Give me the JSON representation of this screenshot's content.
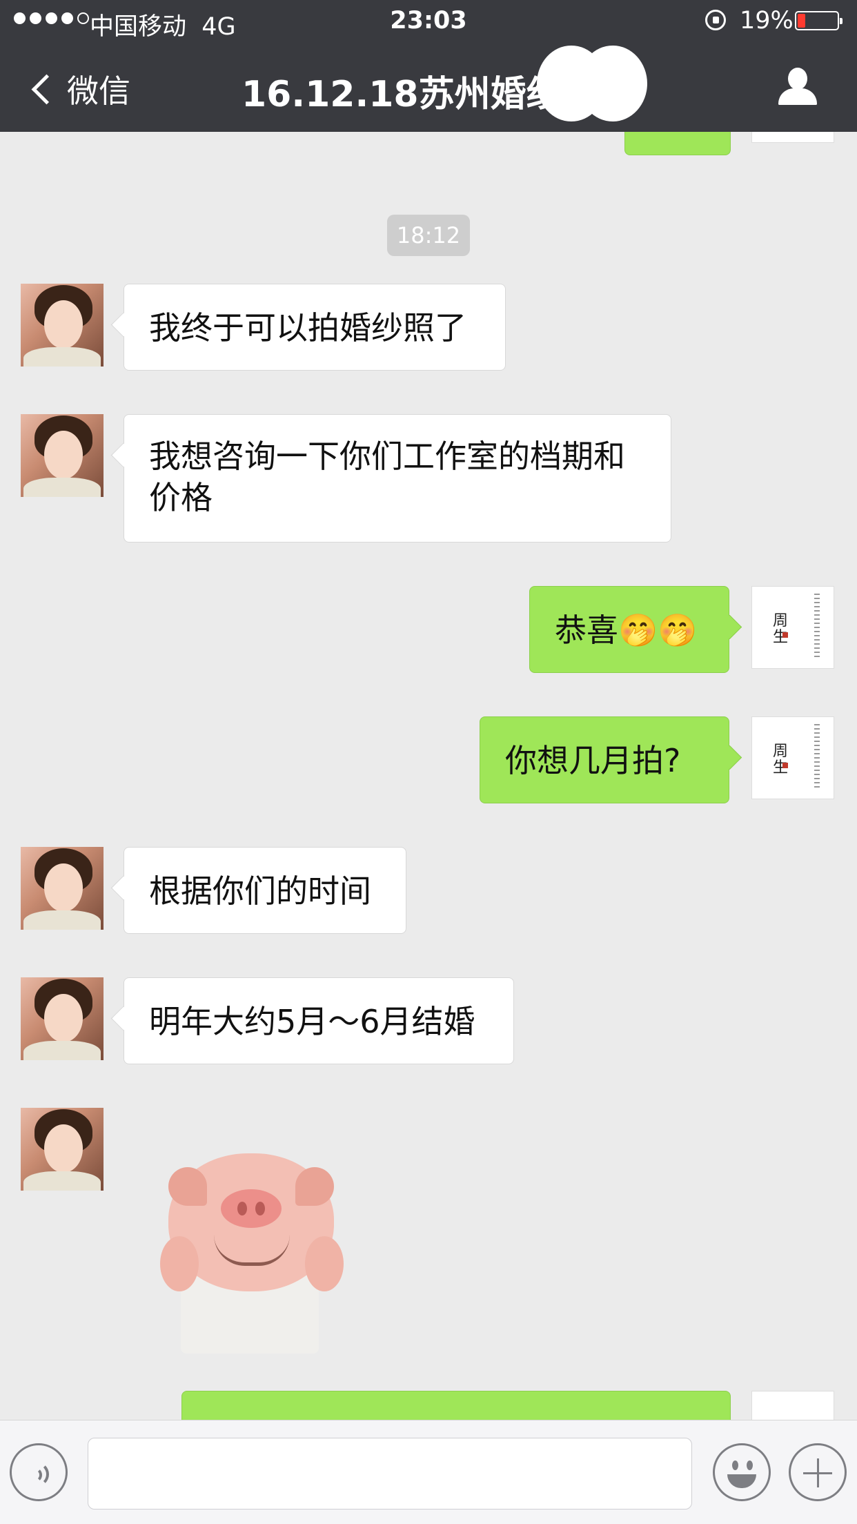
{
  "status_bar": {
    "carrier": "中国移动",
    "network": "4G",
    "time": "23:03",
    "battery_percent": "19%",
    "battery_level": 0.19,
    "battery_color": "#ff3b30"
  },
  "nav": {
    "back_label": "微信",
    "title": "16.12.18苏州婚纱",
    "back_icon": "chevron-left-icon",
    "profile_icon": "person-icon"
  },
  "chat": {
    "timestamp": "18:12",
    "messages": [
      {
        "side": "left",
        "text": "我终于可以拍婚纱照了"
      },
      {
        "side": "left",
        "text": "我想咨询一下你们工作室的档期和价格"
      },
      {
        "side": "right",
        "text": "恭喜🤭🤭"
      },
      {
        "side": "right",
        "text": "你想几月拍?"
      },
      {
        "side": "left",
        "text": "根据你们的时间"
      },
      {
        "side": "left",
        "text": "明年大约5月～6月结婚"
      },
      {
        "side": "left",
        "sticker": "pig-sticker"
      }
    ],
    "studio_avatar_text": "周生"
  },
  "colors": {
    "nav_bg": "#393a3f",
    "chat_bg": "#ebebeb",
    "sent_bubble": "#9fe658",
    "received_bubble": "#ffffff"
  },
  "input_bar": {
    "voice_icon": "voice-icon",
    "emoji_icon": "emoji-icon",
    "plus_icon": "plus-icon",
    "input_value": ""
  }
}
